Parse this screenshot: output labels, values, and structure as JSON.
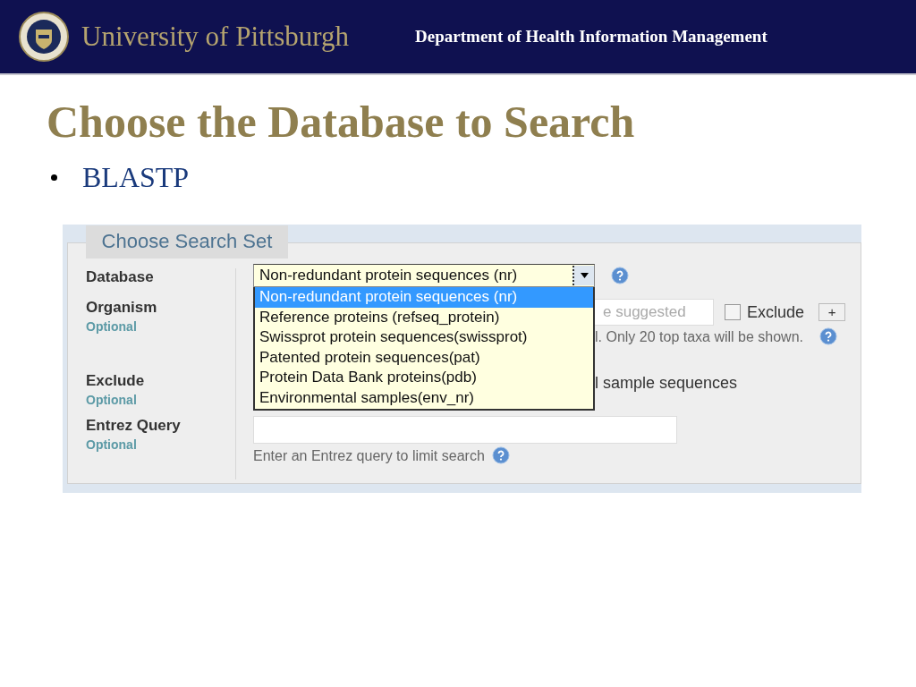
{
  "header": {
    "university": "University of Pittsburgh",
    "department": "Department of Health Information Management"
  },
  "title": "Choose the Database to Search",
  "bullets": [
    "BLASTP"
  ],
  "form": {
    "tab": "Choose Search Set",
    "database": {
      "label": "Database",
      "value": "Non-redundant protein sequences (nr)",
      "expanded": true,
      "options": [
        {
          "label": "Non-redundant protein sequences (nr)",
          "selected": true
        },
        {
          "label": "Reference proteins (refseq_protein)",
          "selected": false
        },
        {
          "label": "Swissprot protein sequences(swissprot)",
          "selected": false
        },
        {
          "label": "Patented protein sequences(pat)",
          "selected": false
        },
        {
          "label": "Protein Data Bank proteins(pdb)",
          "selected": false
        },
        {
          "label": "Environmental samples(env_nr)",
          "selected": false
        }
      ]
    },
    "organism": {
      "label": "Organism",
      "note": "Optional",
      "placeholder": "e suggested",
      "exclude": {
        "label": "Exclude",
        "checked": false
      },
      "add_button": "+",
      "hint": "l. Only 20 top taxa will be shown."
    },
    "exclude": {
      "label": "Exclude",
      "note": "Optional",
      "option_text": "l sample sequences"
    },
    "entrez": {
      "label": "Entrez Query",
      "note": "Optional",
      "hint": "Enter an Entrez query to limit search"
    }
  }
}
